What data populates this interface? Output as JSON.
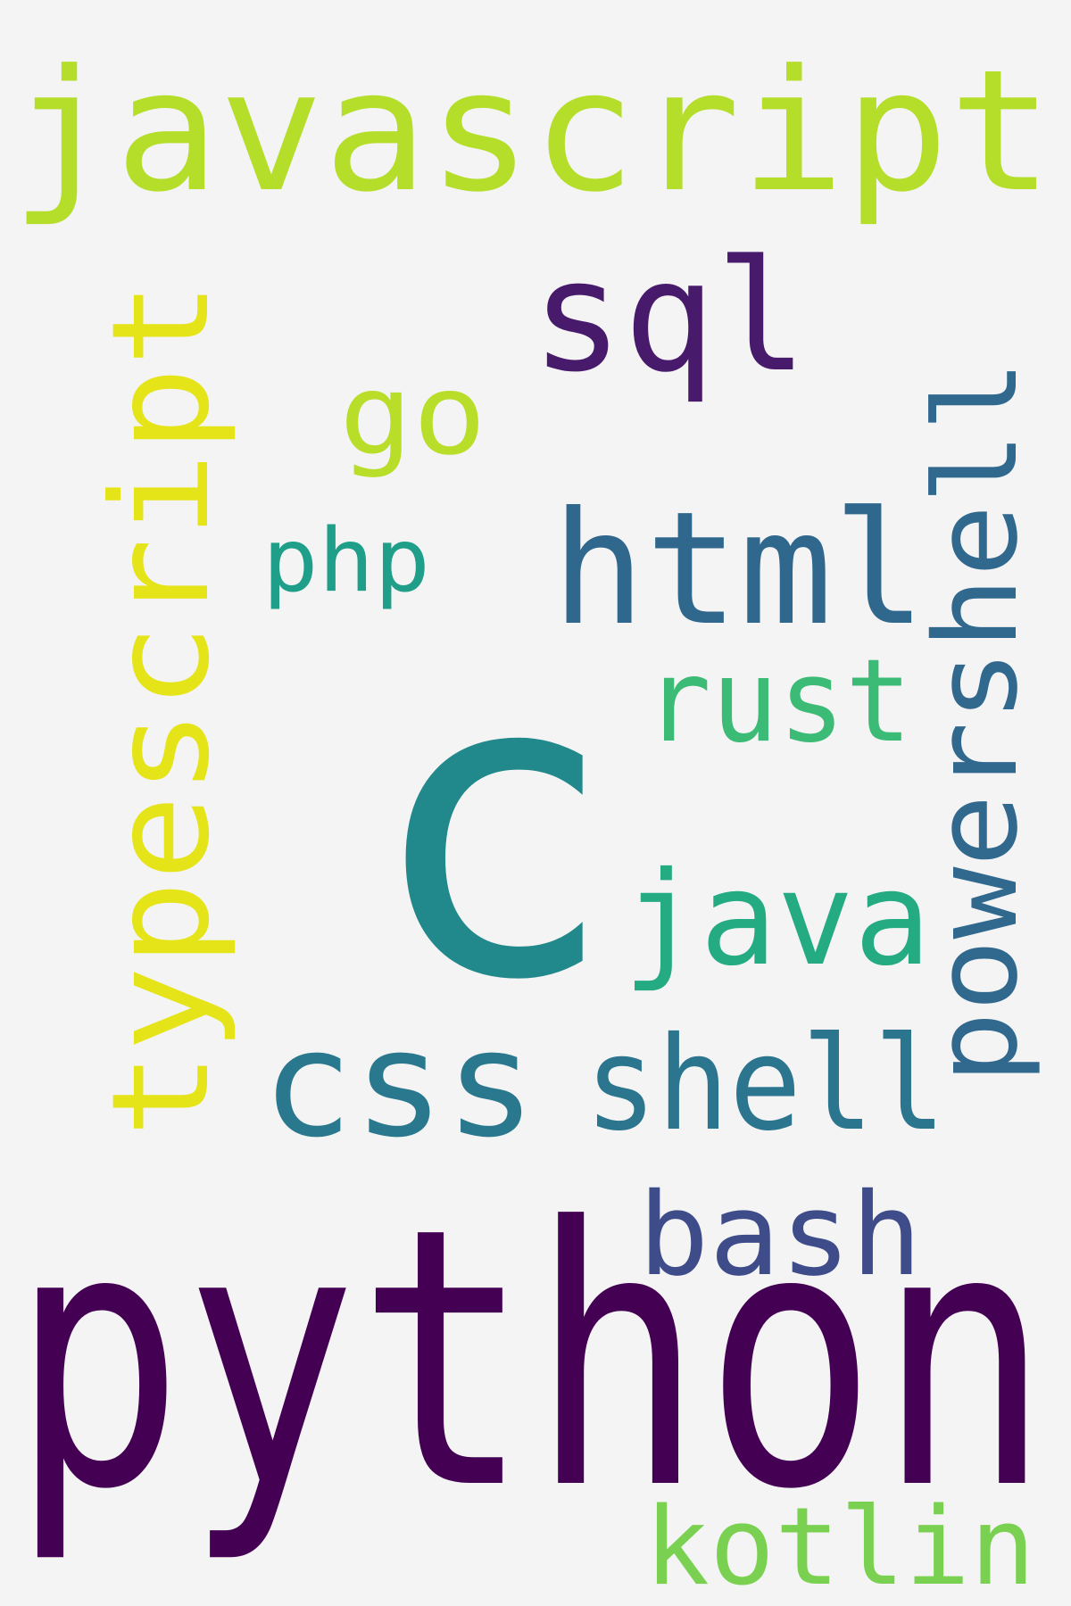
{
  "background": "#f4f4f4",
  "colormap": "viridis",
  "words": [
    {
      "key": "python",
      "text": "python",
      "color": "#440154"
    },
    {
      "key": "c",
      "text": "c",
      "color": "#21888c"
    },
    {
      "key": "javascript",
      "text": "javascript",
      "color": "#b5de2b"
    },
    {
      "key": "typescript",
      "text": "typescript",
      "color": "#e5e419"
    },
    {
      "key": "html",
      "text": "html",
      "color": "#30678d"
    },
    {
      "key": "powershell",
      "text": "powershell",
      "color": "#31688e"
    },
    {
      "key": "sql",
      "text": "sql",
      "color": "#481a6c"
    },
    {
      "key": "css",
      "text": "css",
      "color": "#2a788e"
    },
    {
      "key": "shell",
      "text": "shell",
      "color": "#2b758e"
    },
    {
      "key": "java",
      "text": "java",
      "color": "#25ab82"
    },
    {
      "key": "go",
      "text": "go",
      "color": "#b8de29"
    },
    {
      "key": "rust",
      "text": "rust",
      "color": "#3bbb75"
    },
    {
      "key": "bash",
      "text": "bash",
      "color": "#3e4c8a"
    },
    {
      "key": "php",
      "text": "php",
      "color": "#1f9e89"
    },
    {
      "key": "kotlin",
      "text": "kotlin",
      "color": "#7ad151"
    }
  ]
}
